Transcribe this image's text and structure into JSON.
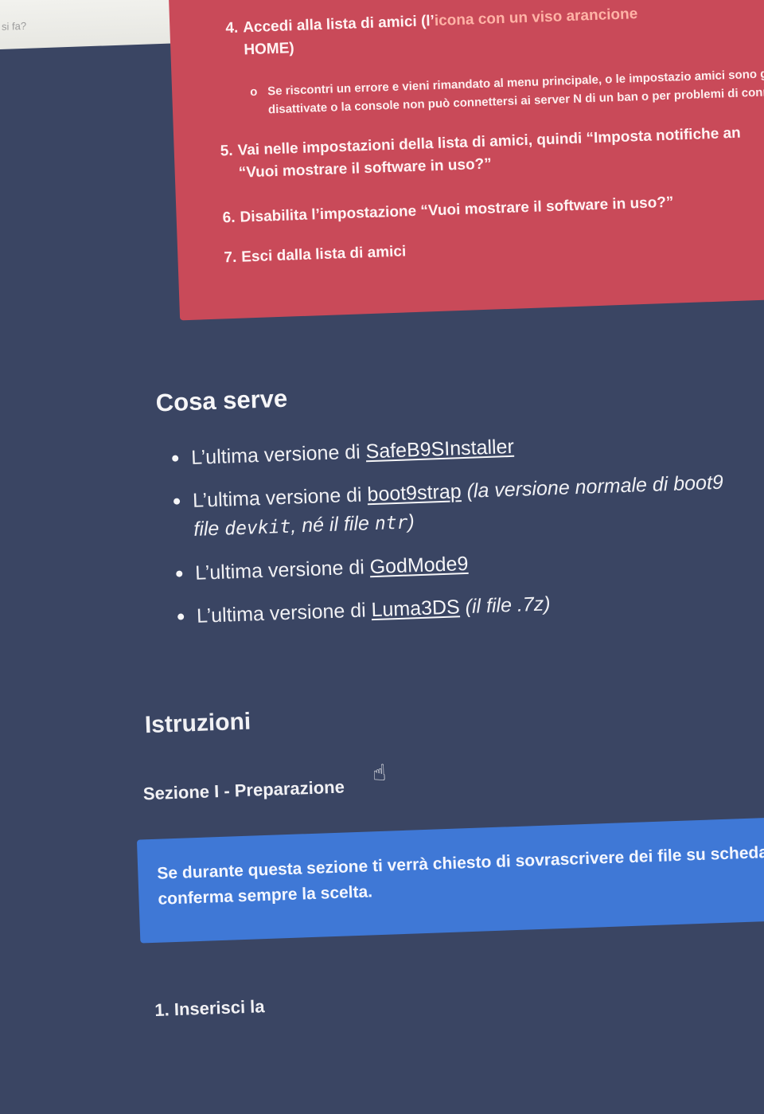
{
  "browser": {
    "snippet": "si fa?"
  },
  "warning_steps": [
    {
      "num": "4.",
      "text": "Accedi alla lista di amici (l’",
      "highlight": "icona con un viso arancione",
      "tail": "HOME)"
    },
    {
      "num": "5.",
      "text": "Vai nelle impostazioni della lista di amici, quindi “Imposta notifiche an",
      "tail": "“Vuoi mostrare il software in uso?”"
    },
    {
      "num": "6.",
      "text": "Disabilita l’impostazione “Vuoi mostrare il software in uso?”"
    },
    {
      "num": "7.",
      "text": "Esci dalla lista di amici"
    }
  ],
  "warning_subnote": "Se riscontri un errore e vieni rimandato al menu principale, o le impostazio amici sono già state disattivate o la console non può connettersi ai server N di un ban o per problemi di connettività)",
  "requirements": {
    "title": "Cosa serve",
    "items": [
      {
        "prefix": "L’ultima versione di ",
        "link": "SafeB9SInstaller",
        "suffix": ""
      },
      {
        "prefix": "L’ultima versione di ",
        "link": "boot9strap",
        "suffix_italic": "(la versione normale di boot9",
        "suffix_line2_a": "file ",
        "suffix_line2_code": "devkit",
        "suffix_line2_b": ", né il file ",
        "suffix_line2_code2": "ntr",
        "suffix_line2_c": ")"
      },
      {
        "prefix": "L’ultima versione di ",
        "link": "GodMode9",
        "suffix": ""
      },
      {
        "prefix": "L’ultima versione di ",
        "link": "Luma3DS",
        "suffix_italic": "(il file .7z)"
      }
    ]
  },
  "instructions": {
    "title": "Istruzioni",
    "section_title": "Sezione I - Preparazione",
    "info_box": "Se durante questa sezione ti verrà chiesto di sovrascrivere dei file su scheda SD, conferma sempre la scelta.",
    "first_step": "1. Inserisci la"
  },
  "colors": {
    "background": "#3a4563",
    "danger": "#c94a59",
    "info": "#3f78d6"
  }
}
